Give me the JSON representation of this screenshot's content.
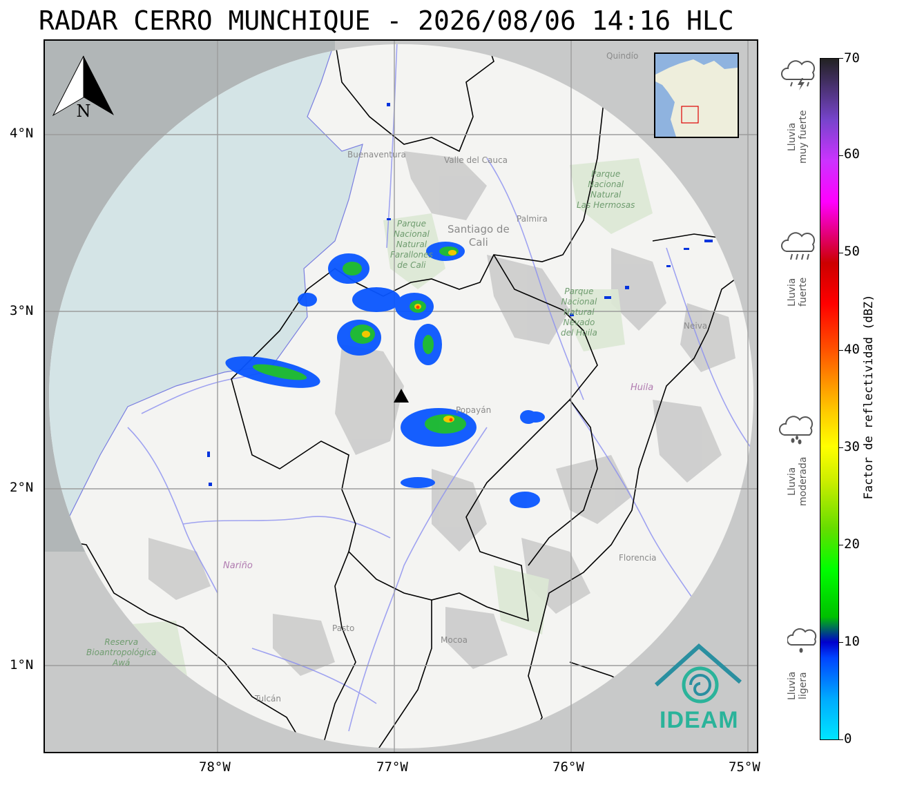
{
  "title": "RADAR CERRO MUNCHIQUE - 2026/08/06 14:16 HLC",
  "north_arrow": {
    "label": "N"
  },
  "axes": {
    "latitude_labels": [
      "4°N",
      "3°N",
      "2°N",
      "1°N"
    ],
    "longitude_labels": [
      "78°W",
      "77°W",
      "76°W",
      "75°W"
    ]
  },
  "colorbar": {
    "title": "Factor de reflectividad (dBZ)",
    "ticks": [
      "0",
      "10",
      "20",
      "30",
      "40",
      "50",
      "60",
      "70"
    ],
    "min": 0,
    "max": 70
  },
  "rain_categories": [
    {
      "label": "Lluvia\nmuy fuerte",
      "icon": "storm-cloud-lightning-icon"
    },
    {
      "label": "Lluvia\nfuerte",
      "icon": "heavy-rain-cloud-icon"
    },
    {
      "label": "Lluvia\nmoderada",
      "icon": "moderate-rain-cloud-icon"
    },
    {
      "label": "Lluvia\nligera",
      "icon": "light-rain-cloud-icon"
    }
  ],
  "map_labels": {
    "cities": [
      "Quindío",
      "Buenaventura",
      "Valle del Cauca",
      "Palmira",
      "Santiago de\nCali",
      "Neiva",
      "Huila",
      "Popayán",
      "Nariño",
      "Florencia",
      "Pasto",
      "Mocoa",
      "Tulcán"
    ],
    "parks": [
      "Parque\nNacional\nNatural\nLas Hermosas",
      "Parque\nNacional\nNatural\nFarallones\nde Cali",
      "Parque\nNacional\nNatural\nNevado\ndel Huila",
      "Reserva\nBioantropológica\nAwá"
    ]
  },
  "logo": {
    "text": "IDEAM"
  },
  "colors": {
    "radar_disk": "#f4f4f2",
    "outside_range": "#c9c9c9",
    "sea": "#d6e6e7",
    "logo": "#2bb39a",
    "radar_site_marker": "#000000"
  }
}
